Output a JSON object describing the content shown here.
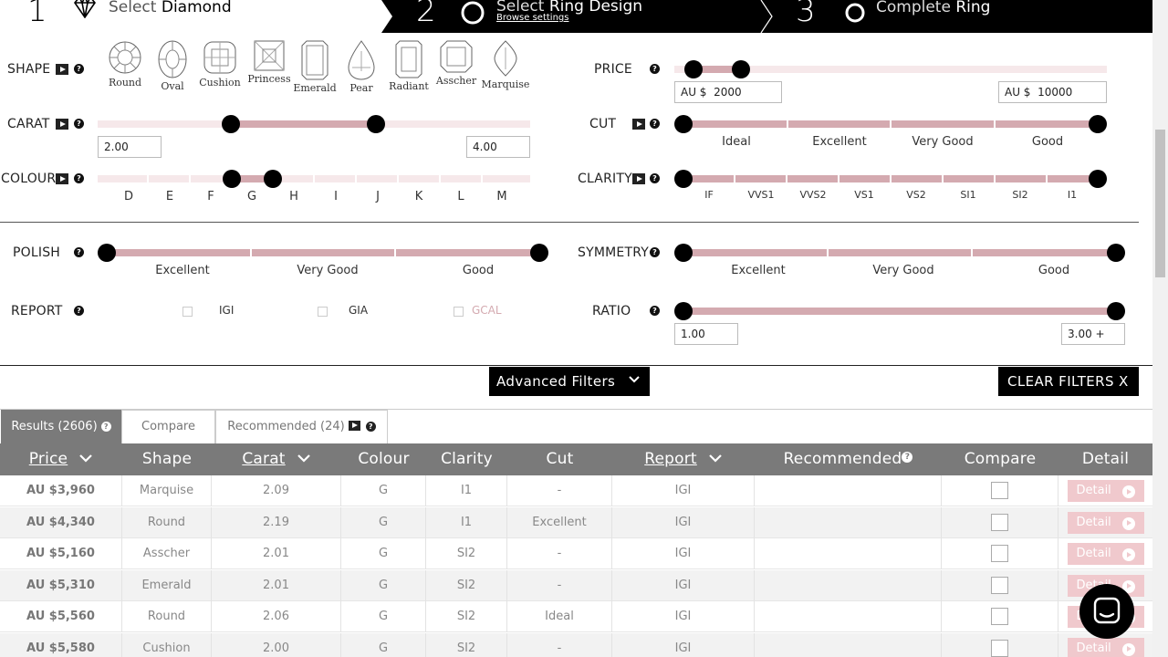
{
  "steps": {
    "step1": {
      "num": "1",
      "prefix": "Select",
      "title": "Diamond"
    },
    "step2": {
      "num": "2",
      "prefix": "Select",
      "title": "Ring Design",
      "sub": "Browse settings"
    },
    "step3": {
      "num": "3",
      "prefix": "Complete",
      "title": "Ring"
    }
  },
  "filters": {
    "shape": {
      "label": "SHAPE",
      "items": [
        "Round",
        "Oval",
        "Cushion",
        "Princess",
        "Emerald",
        "Pear",
        "Radiant",
        "Asscher",
        "Marquise"
      ]
    },
    "carat": {
      "label": "CARAT",
      "min": "2.00",
      "max": "4.00"
    },
    "colour": {
      "label": "COLOUR",
      "ticks": [
        "D",
        "E",
        "F",
        "G",
        "H",
        "I",
        "J",
        "K",
        "L",
        "M"
      ]
    },
    "price": {
      "label": "PRICE",
      "currency": "AU $",
      "min": "2000",
      "max": "10000"
    },
    "cut": {
      "label": "CUT",
      "ticks": [
        "Ideal",
        "Excellent",
        "Very Good",
        "Good"
      ]
    },
    "clarity": {
      "label": "CLARITY",
      "ticks": [
        "IF",
        "VVS1",
        "VVS2",
        "VS1",
        "VS2",
        "SI1",
        "SI2",
        "I1"
      ]
    },
    "polish": {
      "label": "POLISH",
      "ticks": [
        "Excellent",
        "Very Good",
        "Good"
      ]
    },
    "symmetry": {
      "label": "SYMMETRY",
      "ticks": [
        "Excellent",
        "Very Good",
        "Good"
      ]
    },
    "report": {
      "label": "REPORT",
      "options": [
        "IGI",
        "GIA",
        "GCAL"
      ]
    },
    "ratio": {
      "label": "RATIO",
      "min": "1.00",
      "max": "3.00 +"
    }
  },
  "buttons": {
    "advanced": "Advanced Filters",
    "clear": "CLEAR FILTERS X"
  },
  "tabs": {
    "results": "Results (2606)",
    "compare": "Compare",
    "recommended": "Recommended (24)"
  },
  "table": {
    "headers": {
      "price": "Price",
      "shape": "Shape",
      "carat": "Carat",
      "colour": "Colour",
      "clarity": "Clarity",
      "cut": "Cut",
      "report": "Report",
      "recommended": "Recommended",
      "compare": "Compare",
      "detail": "Detail"
    },
    "detail_label": "Detail",
    "rows": [
      {
        "price": "AU $3,960",
        "shape": "Marquise",
        "carat": "2.09",
        "colour": "G",
        "clarity": "I1",
        "cut": "-",
        "report": "IGI"
      },
      {
        "price": "AU $4,340",
        "shape": "Round",
        "carat": "2.19",
        "colour": "G",
        "clarity": "I1",
        "cut": "Excellent",
        "report": "IGI"
      },
      {
        "price": "AU $5,160",
        "shape": "Asscher",
        "carat": "2.01",
        "colour": "G",
        "clarity": "SI2",
        "cut": "-",
        "report": "IGI"
      },
      {
        "price": "AU $5,310",
        "shape": "Emerald",
        "carat": "2.01",
        "colour": "G",
        "clarity": "SI2",
        "cut": "-",
        "report": "IGI"
      },
      {
        "price": "AU $5,560",
        "shape": "Round",
        "carat": "2.06",
        "colour": "G",
        "clarity": "SI2",
        "cut": "Ideal",
        "report": "IGI"
      },
      {
        "price": "AU $5,580",
        "shape": "Cushion",
        "carat": "2.00",
        "colour": "G",
        "clarity": "SI2",
        "cut": "-",
        "report": "IGI"
      }
    ]
  }
}
